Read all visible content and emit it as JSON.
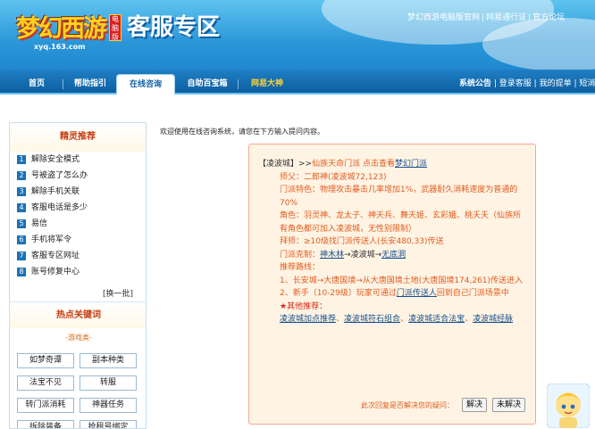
{
  "header": {
    "logo_text": "梦幻西游",
    "logo_badge": "电脑版",
    "logo_url": "xyq.163.com",
    "section_title": "客服专区",
    "top_links": [
      "梦幻西游电脑版官网",
      "网易通行证",
      "官方论坛"
    ]
  },
  "nav": {
    "tabs": [
      {
        "label": "首页"
      },
      {
        "label": "帮助指引"
      },
      {
        "label": "在线咨询"
      },
      {
        "label": "自助百宝箱"
      },
      {
        "label": "网易大神"
      }
    ],
    "right_links": [
      "系统公告",
      "登录客服",
      "我的提单",
      "短消"
    ]
  },
  "sidebar": {
    "title": "精灵推荐",
    "items": [
      {
        "num": "1",
        "label": "解除安全模式"
      },
      {
        "num": "2",
        "label": "号被盗了怎么办"
      },
      {
        "num": "3",
        "label": "解除手机关联"
      },
      {
        "num": "4",
        "label": "客服电话是多少"
      },
      {
        "num": "5",
        "label": "易信"
      },
      {
        "num": "6",
        "label": "手机将军令"
      },
      {
        "num": "7",
        "label": "客服专区网址"
      },
      {
        "num": "8",
        "label": "账号修复中心"
      }
    ],
    "more": "[换一批]",
    "hot_title": "热点关键词",
    "hot_category": "-游戏类-",
    "keywords": [
      "如梦奇谭",
      "副本种类",
      "法宝不见",
      "转服",
      "转门派消耗",
      "神器任务",
      "拆除装备",
      "抢租号绑定"
    ]
  },
  "main": {
    "welcome": "欢迎使用在线咨询系统，请您在下方输入提问内容。"
  },
  "answer": {
    "title_prefix": "【凌波城】>>",
    "title_text": "仙族天命门派 点击查看",
    "title_link": "梦幻门派",
    "master": "师父：二郎神(凌波城72,123)",
    "feature": "门派特色：物理攻击暴击几率增加1%，武器耐久消耗速度为普通的70%",
    "roles": "角色：羽灵神、龙太子、神天兵、舞天姬、玄彩娥、桃夭夭（仙族所有角色都可加入凌波城，无性别限制）",
    "join": "拜师：≥10级找门派传送人(长安480,33)传送",
    "restrain_label": "门派克制：",
    "restrain_a": "神木林",
    "restrain_mid": "凌波城",
    "restrain_b": "无底洞",
    "route_label": "推荐路线：",
    "route1": "1、长安城→大唐国境→从大唐国境土地(大唐国境174,261)传送进入",
    "route2_pre": "2、新手（10-29级）玩家可通过",
    "route2_link": "门派传送人",
    "route2_post": "回到自己门派场景中",
    "other_label": "★其他推荐：",
    "other_links": [
      "凌波城加点推荐",
      "凌波城符石组合",
      "凌波城适合法宝",
      "凌波城经脉"
    ],
    "feedback_q": "此次回复是否解决您的疑问：",
    "btn_yes": "解决",
    "btn_no": "未解决"
  },
  "colors": {
    "header_blue": "#2b97d9",
    "nav_blue": "#0d5f9f",
    "accent_orange": "#e15b1e",
    "answer_bg": "#fff4e4"
  }
}
